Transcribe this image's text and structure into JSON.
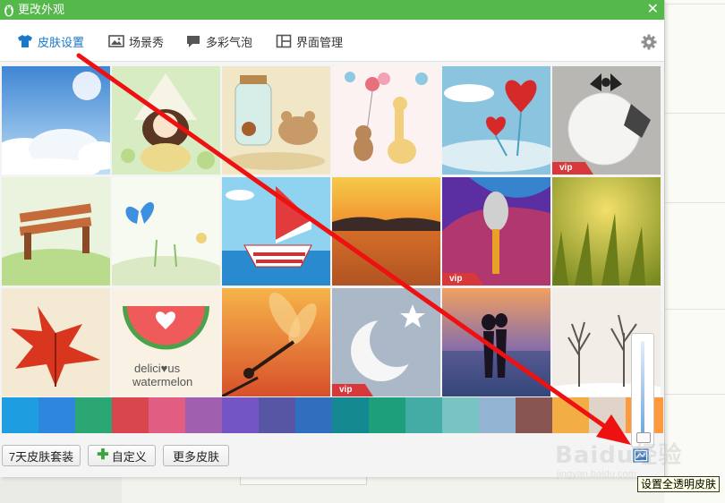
{
  "window": {
    "title": "更改外观",
    "close": "✕"
  },
  "tabs": [
    {
      "label": "皮肤设置",
      "icon": "tshirt-icon",
      "active": true
    },
    {
      "label": "场景秀",
      "icon": "image-icon"
    },
    {
      "label": "多彩气泡",
      "icon": "speech-bubble-icon"
    },
    {
      "label": "界面管理",
      "icon": "layout-icon"
    }
  ],
  "thumbnails": [
    {
      "name": "sky-clouds",
      "vip": false
    },
    {
      "name": "girl-with-hat",
      "vip": false
    },
    {
      "name": "jar-and-bear",
      "vip": false
    },
    {
      "name": "bear-giraffe-balloons",
      "vip": false
    },
    {
      "name": "heart-tree",
      "vip": false
    },
    {
      "name": "plate-bowtie",
      "vip": true
    },
    {
      "name": "bench-meadow",
      "vip": false
    },
    {
      "name": "butterfly-flowers",
      "vip": false
    },
    {
      "name": "sailboat",
      "vip": false
    },
    {
      "name": "lake-sunset",
      "vip": false
    },
    {
      "name": "microphone",
      "vip": true
    },
    {
      "name": "grass-bokeh",
      "vip": false
    },
    {
      "name": "red-leaf",
      "vip": false
    },
    {
      "name": "watermelon",
      "vip": false,
      "caption1": "delici♥us",
      "caption2": "watermelon"
    },
    {
      "name": "dragonfly",
      "vip": false
    },
    {
      "name": "moon-star",
      "vip": true
    },
    {
      "name": "couple-beach",
      "vip": false
    },
    {
      "name": "winter-trees",
      "vip": false
    }
  ],
  "vip_label": "vip",
  "colors": [
    "#1e9ee0",
    "#2f86de",
    "#2aa772",
    "#d9464e",
    "#e15d82",
    "#a15fb0",
    "#7455c6",
    "#5756a4",
    "#2f6fbe",
    "#14898f",
    "#1e9f7c",
    "#44aca4",
    "#78c4c2",
    "#94b4d4",
    "#895552",
    "#f2ad44",
    "#dfd4c7",
    "#ff9a3c"
  ],
  "buttons": {
    "seven_day": "7天皮肤套装",
    "custom": "自定义",
    "more": "更多皮肤"
  },
  "tooltip": "设置全透明皮肤",
  "watermark": {
    "line1": "Baidu经验",
    "line2": "jingyan.baidu.com"
  },
  "accent": "#54b84a",
  "arrow_color": "#ee1111"
}
